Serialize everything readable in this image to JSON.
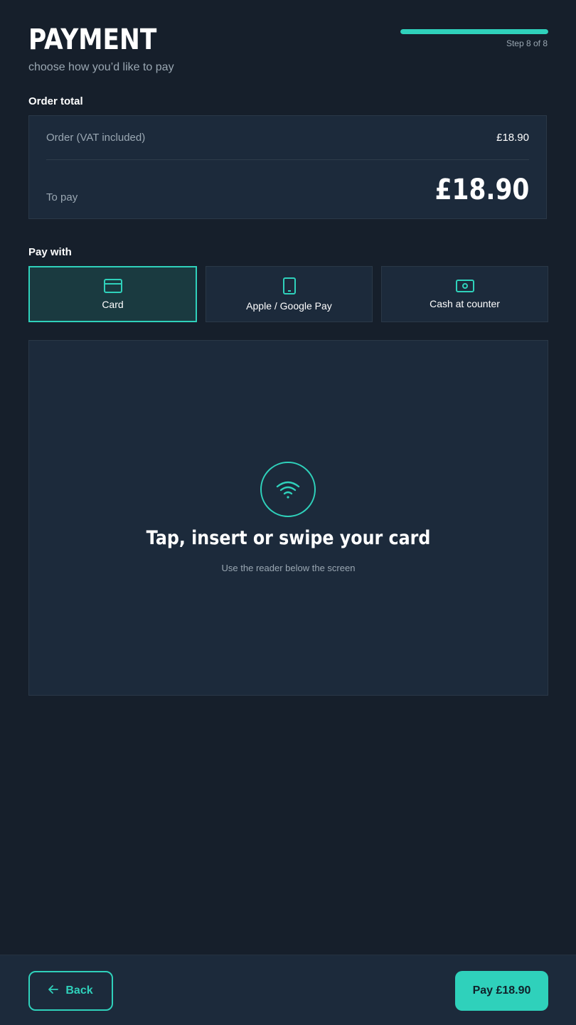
{
  "header": {
    "title": "PAYMENT",
    "subtitle": "choose how you’d like to pay",
    "step_label": "Step 8 of 8",
    "progress": 1.0
  },
  "order": {
    "section_label": "Order total",
    "order_label": "Order (VAT included)",
    "order_value": "£18.90",
    "to_pay_label": "To pay",
    "to_pay_value": "£18.90"
  },
  "pay_with": {
    "section_label": "Pay with",
    "options": [
      {
        "label": "Card",
        "icon": "credit-card-icon",
        "selected": true
      },
      {
        "label": "Apple / Google Pay",
        "icon": "phone-icon",
        "selected": false
      },
      {
        "label": "Cash at counter",
        "icon": "cash-icon",
        "selected": false
      }
    ]
  },
  "reader": {
    "icon": "contactless-icon",
    "title": "Tap, insert or swipe your card",
    "subtitle": "Use the reader below the screen"
  },
  "footer": {
    "back_label": "Back",
    "back_icon": "arrow-left-icon",
    "pay_label": "Pay £18.90"
  },
  "colors": {
    "background": "#161f2b",
    "panel": "#1c2a3b",
    "accent": "#2fd1bb"
  }
}
